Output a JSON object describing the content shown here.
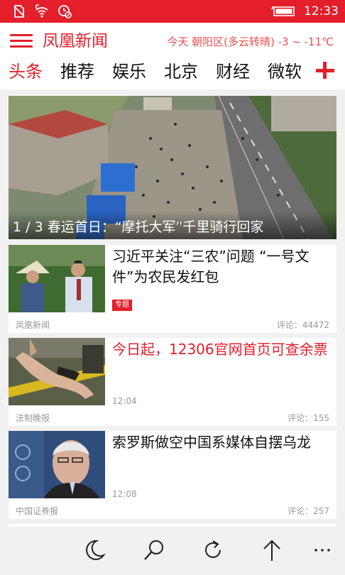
{
  "status_bar": {
    "time": "12:33",
    "icons": [
      "sim-off-icon",
      "wifi-icon",
      "data-off-icon",
      "battery-icon"
    ]
  },
  "header": {
    "app_title": "凤凰新闻",
    "weather": "今天 朝阳区(多云转晴) -3 ~ -11℃",
    "menu_icon": "hamburger-menu-icon"
  },
  "tabs": [
    "头条",
    "推荐",
    "娱乐",
    "北京",
    "财经",
    "微软"
  ],
  "active_tab": 0,
  "add_tab_icon": "plus-icon",
  "hero": {
    "caption": "1 / 3 春运首日：“摩托大军”千里骑行回家"
  },
  "news": [
    {
      "title": "习近平关注“三农”问题 “一号文件”为农民发红包",
      "badge": "专题",
      "time": "",
      "source": "凤凰新闻",
      "comments": "评论：44472",
      "highlight": false
    },
    {
      "title": "今日起，12306官网首页可查余票",
      "badge": "",
      "time": "12:04",
      "source": "法制晚报",
      "comments": "评论：155",
      "highlight": true
    },
    {
      "title": "索罗斯做空中国系媒体自摆乌龙",
      "badge": "",
      "time": "12:08",
      "source": "中国证券报",
      "comments": "评论：257",
      "highlight": false
    }
  ],
  "app_bar": [
    "night-mode-icon",
    "search-icon",
    "refresh-icon",
    "back-to-top-icon",
    "more-icon"
  ],
  "colors": {
    "accent": "#e41e2b",
    "background": "#f1f1f1",
    "muted_text": "#999999"
  }
}
